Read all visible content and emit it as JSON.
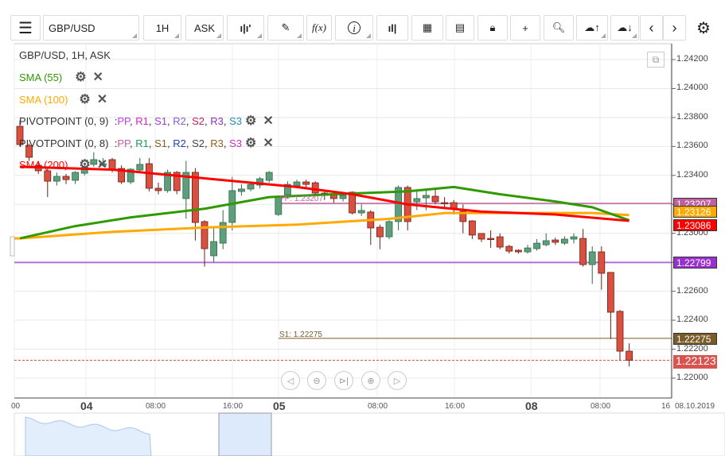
{
  "toolbar": {
    "symbol": "GBP/USD",
    "timeframe": "1H",
    "price_type": "ASK"
  },
  "legend": {
    "title": "GBP/USD, 1H, ASK",
    "sma55": "SMA (55)",
    "sma100": "SMA (100)",
    "sma200": "SMA (200)",
    "pivot1": {
      "label": "PIVOTPOINT (0, 9)",
      "sep": ": ",
      "items": [
        {
          "t": "PP",
          "c": "#c040e0"
        },
        {
          "t": "R1",
          "c": "#e020c0"
        },
        {
          "t": "S1",
          "c": "#a040d0"
        },
        {
          "t": "R2",
          "c": "#8060d0"
        },
        {
          "t": "S2",
          "c": "#c02060"
        },
        {
          "t": "R3",
          "c": "#9030c0"
        },
        {
          "t": "S3",
          "c": "#2090b0"
        }
      ]
    },
    "pivot2": {
      "label": "PIVOTPOINT (0, 8)",
      "sep": ": ",
      "items": [
        {
          "t": "PP",
          "c": "#c060a0"
        },
        {
          "t": "R1",
          "c": "#10a060"
        },
        {
          "t": "S1",
          "c": "#806020"
        },
        {
          "t": "R2",
          "c": "#2040b0"
        },
        {
          "t": "S2",
          "c": "#444444"
        },
        {
          "t": "R3",
          "c": "#906020"
        },
        {
          "t": "S3",
          "c": "#c030c0"
        }
      ]
    }
  },
  "colors": {
    "up": "#5f9e7c",
    "down": "#d9503f",
    "sma55": "#2e9a00",
    "sma100": "#ffaa00",
    "sma200": "#ff0000",
    "pp": "#c0609f",
    "s_purple": "#b070d8",
    "s1": "#7a5c28",
    "last": "#d9534f"
  },
  "chart_data": {
    "type": "candlestick",
    "symbol": "GBP/USD",
    "interval": "1H",
    "ylim": [
      1.2192,
      1.2428
    ],
    "y_ticks": [
      "1.24200",
      "1.24000",
      "1.23800",
      "1.23600",
      "1.23400",
      "1.23200",
      "1.23000",
      "1.22800",
      "1.22600",
      "1.22400",
      "1.22200",
      "1.22000"
    ],
    "x_ticks": [
      {
        "t": "00",
        "big": false
      },
      {
        "t": "04",
        "big": true
      },
      {
        "t": "08:00",
        "big": false
      },
      {
        "t": "16:00",
        "big": false
      },
      {
        "t": "05",
        "big": true
      },
      {
        "t": "08:00",
        "big": false
      },
      {
        "t": "16:00",
        "big": false
      },
      {
        "t": "08",
        "big": true
      },
      {
        "t": "08:00",
        "big": false
      },
      {
        "t": "16",
        "big": false
      }
    ],
    "date_label": "08.10.2019",
    "candles": [
      [
        0,
        1.23739,
        1.2378,
        1.236,
        1.23613
      ],
      [
        1,
        1.23607,
        1.2362,
        1.235,
        1.23525
      ],
      [
        2,
        1.2347,
        1.235,
        1.2341,
        1.23432
      ],
      [
        3,
        1.23432,
        1.2345,
        1.2325,
        1.2336
      ],
      [
        4,
        1.2336,
        1.2342,
        1.2333,
        1.23393
      ],
      [
        5,
        1.23393,
        1.2341,
        1.2334,
        1.23371
      ],
      [
        6,
        1.23366,
        1.2343,
        1.2334,
        1.23421
      ],
      [
        7,
        1.23415,
        1.2348,
        1.234,
        1.23448
      ],
      [
        8,
        1.23476,
        1.2356,
        1.2346,
        1.23509
      ],
      [
        9,
        1.2347,
        1.2352,
        1.2346,
        1.23481
      ],
      [
        10,
        1.23509,
        1.2352,
        1.2342,
        1.23437
      ],
      [
        11,
        1.23448,
        1.2347,
        1.2334,
        1.23355
      ],
      [
        12,
        1.23355,
        1.2345,
        1.2334,
        1.23443
      ],
      [
        13,
        1.23437,
        1.2352,
        1.2342,
        1.23476
      ],
      [
        14,
        1.23481,
        1.2352,
        1.2329,
        1.23311
      ],
      [
        15,
        1.23311,
        1.2335,
        1.2327,
        1.23295
      ],
      [
        16,
        1.23295,
        1.2344,
        1.2328,
        1.23421
      ],
      [
        17,
        1.23421,
        1.2343,
        1.2327,
        1.23295
      ],
      [
        18,
        1.2324,
        1.235,
        1.231,
        1.23421
      ],
      [
        19,
        1.23421,
        1.2345,
        1.2295,
        1.23075
      ],
      [
        20,
        1.23081,
        1.2309,
        1.2277,
        1.22894
      ],
      [
        21,
        1.22845,
        1.2305,
        1.228,
        1.22943
      ],
      [
        22,
        1.22932,
        1.2316,
        1.2289,
        1.23075
      ],
      [
        23,
        1.23075,
        1.2339,
        1.2302,
        1.23295
      ],
      [
        24,
        1.23289,
        1.2334,
        1.2326,
        1.23306
      ],
      [
        25,
        1.23306,
        1.2335,
        1.2329,
        1.23338
      ],
      [
        26,
        1.23333,
        1.2339,
        1.2331,
        1.23377
      ],
      [
        27,
        1.23366,
        1.2343,
        1.2335,
        1.23421
      ],
      [
        28,
        1.2313,
        1.2326,
        1.2312,
        1.23256
      ],
      [
        29,
        1.23267,
        1.2336,
        1.2324,
        1.23338
      ],
      [
        30,
        1.23328,
        1.2337,
        1.2331,
        1.23355
      ],
      [
        31,
        1.23355,
        1.2337,
        1.2331,
        1.23338
      ],
      [
        32,
        1.23349,
        1.2336,
        1.2326,
        1.23278
      ],
      [
        33,
        1.23278,
        1.233,
        1.2323,
        1.23262
      ],
      [
        34,
        1.23267,
        1.2329,
        1.2321,
        1.2324
      ],
      [
        35,
        1.2324,
        1.2328,
        1.2322,
        1.23262
      ],
      [
        36,
        1.23284,
        1.2329,
        1.2313,
        1.23141
      ],
      [
        37,
        1.23141,
        1.232,
        1.2312,
        1.23158
      ],
      [
        38,
        1.23147,
        1.2316,
        1.2292,
        1.23037
      ],
      [
        39,
        1.23042,
        1.2306,
        1.2289,
        1.22976
      ],
      [
        40,
        1.22976,
        1.2309,
        1.2296,
        1.23081
      ],
      [
        41,
        1.23081,
        1.2333,
        1.2302,
        1.23317
      ],
      [
        42,
        1.23317,
        1.2333,
        1.2302,
        1.23081
      ],
      [
        43,
        1.23218,
        1.2329,
        1.2316,
        1.2324
      ],
      [
        44,
        1.23245,
        1.233,
        1.2316,
        1.23262
      ],
      [
        45,
        1.23256,
        1.233,
        1.232,
        1.23218
      ],
      [
        46,
        1.23212,
        1.2325,
        1.2317,
        1.23208
      ],
      [
        47,
        1.23212,
        1.2323,
        1.2313,
        1.23174
      ],
      [
        48,
        1.23152,
        1.232,
        1.23,
        1.23081
      ],
      [
        49,
        1.23086,
        1.2309,
        1.2296,
        1.22988
      ],
      [
        50,
        1.22999,
        1.23,
        1.2294,
        1.2296
      ],
      [
        51,
        1.22965,
        1.2302,
        1.229,
        1.2296
      ],
      [
        52,
        1.22976,
        1.23,
        1.2289,
        1.22905
      ],
      [
        53,
        1.2291,
        1.2292,
        1.2286,
        1.22877
      ],
      [
        54,
        1.22883,
        1.2289,
        1.2286,
        1.22872
      ],
      [
        55,
        1.22872,
        1.2292,
        1.2286,
        1.22899
      ],
      [
        56,
        1.22894,
        1.2296,
        1.2288,
        1.22932
      ],
      [
        57,
        1.22921,
        1.23,
        1.2291,
        1.22949
      ],
      [
        58,
        1.22954,
        1.2297,
        1.2292,
        1.22938
      ],
      [
        59,
        1.22932,
        1.2298,
        1.2292,
        1.2296
      ],
      [
        60,
        1.2296,
        1.23,
        1.2293,
        1.22976
      ],
      [
        61,
        1.22965,
        1.2303,
        1.2277,
        1.22784
      ],
      [
        62,
        1.22784,
        1.2291,
        1.2265,
        1.22872
      ],
      [
        63,
        1.22872,
        1.2291,
        1.2261,
        1.22724
      ],
      [
        64,
        1.2273,
        1.2273,
        1.2227,
        1.22455
      ],
      [
        65,
        1.22461,
        1.2247,
        1.2212,
        1.22186
      ],
      [
        66,
        1.22186,
        1.2224,
        1.2208,
        1.22123
      ]
    ],
    "sma55": [
      [
        0,
        1.22965
      ],
      [
        6,
        1.2305
      ],
      [
        12,
        1.2311
      ],
      [
        20,
        1.2317
      ],
      [
        27,
        1.2325
      ],
      [
        34,
        1.2327
      ],
      [
        42,
        1.2329
      ],
      [
        47,
        1.2332
      ],
      [
        52,
        1.2327
      ],
      [
        58,
        1.2322
      ],
      [
        62,
        1.2318
      ],
      [
        66,
        1.2309
      ]
    ],
    "sma100": [
      [
        0,
        1.22965
      ],
      [
        10,
        1.2301
      ],
      [
        20,
        1.2304
      ],
      [
        30,
        1.2306
      ],
      [
        40,
        1.231
      ],
      [
        46,
        1.2314
      ],
      [
        55,
        1.2314
      ],
      [
        62,
        1.2314
      ],
      [
        66,
        1.23126
      ]
    ],
    "sma200": [
      [
        0,
        1.2346
      ],
      [
        10,
        1.2344
      ],
      [
        20,
        1.2338
      ],
      [
        30,
        1.2332
      ],
      [
        36,
        1.2327
      ],
      [
        42,
        1.232
      ],
      [
        50,
        1.2315
      ],
      [
        58,
        1.2313
      ],
      [
        66,
        1.23086
      ]
    ],
    "levels": {
      "pp": {
        "label": "PP: 1.23207",
        "value": 1.23207
      },
      "purple": {
        "value": 1.22799
      },
      "s1": {
        "label": "S1: 1.22275",
        "value": 1.22275
      },
      "last": {
        "value": 1.22123
      }
    },
    "badges": {
      "pp": "1.23207",
      "sma100": "1.23126",
      "sma200": "1.23086",
      "purple": "1.22799",
      "s1": "1.22275",
      "last": "1.22123"
    }
  }
}
